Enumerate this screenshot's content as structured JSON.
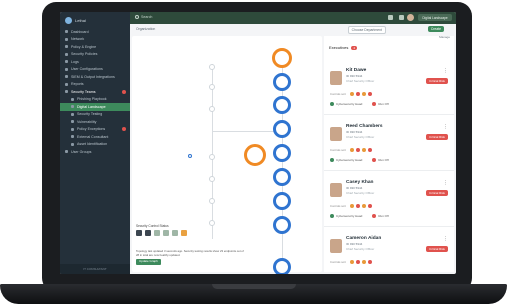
{
  "sidebar": {
    "brand": "Lethal",
    "items": [
      {
        "label": "Dashboard",
        "active": false,
        "sub": false
      },
      {
        "label": "Network",
        "active": false,
        "sub": false
      },
      {
        "label": "Policy & Engine",
        "active": false,
        "sub": false
      },
      {
        "label": "Security Policies",
        "active": false,
        "sub": false
      },
      {
        "label": "Logs",
        "active": false,
        "sub": false
      },
      {
        "label": "User Configurations",
        "active": false,
        "sub": false
      },
      {
        "label": "SIEM & Output Integrations",
        "active": false,
        "sub": false
      },
      {
        "label": "Reports",
        "active": false,
        "sub": false
      },
      {
        "label": "Security Teams",
        "active": false,
        "sub": false,
        "section": true,
        "alert": true
      },
      {
        "label": "Phishing Playbook",
        "active": false,
        "sub": true
      },
      {
        "label": "Digital Landscape",
        "active": true,
        "sub": true
      },
      {
        "label": "Security Testing",
        "active": false,
        "sub": true
      },
      {
        "label": "Vulnerability",
        "active": false,
        "sub": true
      },
      {
        "label": "Policy Exceptions",
        "active": false,
        "sub": true,
        "alert": true
      },
      {
        "label": "External Consultant",
        "active": false,
        "sub": true
      },
      {
        "label": "Asset Identification",
        "active": false,
        "sub": true
      },
      {
        "label": "User Groups",
        "active": false,
        "sub": false
      }
    ],
    "footer": "IT CONSULTANT"
  },
  "topbar": {
    "search_label": "Search",
    "brand_right": "Digital Landscape"
  },
  "subbar": {
    "title": "Organization",
    "department": "Choose Department",
    "create": "Create"
  },
  "canvas": {
    "legend_title": "Security Control Status",
    "note": "Topology last updated 3 seconds ago. Security testing results show 23 endpoints out of 28 in total are now healthy updated.",
    "note_button": "Update Graph"
  },
  "panel": {
    "title": "Executives",
    "badge": "4",
    "search": "Manage",
    "cards": [
      {
        "name": "Kit Dawe",
        "id": "ID 930 5944",
        "role": "Chief Security Officer",
        "tag": "Critical Risk",
        "rating_label": "Controls sort",
        "foot_a": "Cybersecurity Head",
        "foot_b": "Run Off"
      },
      {
        "name": "Reed Chambers",
        "id": "ID 930 5944",
        "role": "Chief Security Officer",
        "tag": "Critical Risk",
        "rating_label": "Controls sort",
        "foot_a": "Cybersecurity Head",
        "foot_b": "Run Off"
      },
      {
        "name": "Casey Khan",
        "id": "ID 930 5944",
        "role": "Chief Security Officer",
        "tag": "Critical Risk",
        "rating_label": "Controls sort",
        "foot_a": "Cybersecurity Head",
        "foot_b": "Run Off"
      },
      {
        "name": "Cameron Aidan",
        "id": "ID 930 5944",
        "role": "Chief Security Officer",
        "tag": "Critical Risk",
        "rating_label": "Controls sort",
        "foot_a": "",
        "foot_b": ""
      }
    ]
  },
  "colors": {
    "sidebar_bg": "#24303a",
    "topbar_bg": "#2e4a3b",
    "accent_green": "#3d8a5c",
    "node_blue": "#2f74d0",
    "node_orange": "#f08a24",
    "alert_red": "#e0524d"
  },
  "icons": [
    "search-icon",
    "bell-icon",
    "settings-icon",
    "user-avatar",
    "more-icon",
    "node-icon"
  ]
}
